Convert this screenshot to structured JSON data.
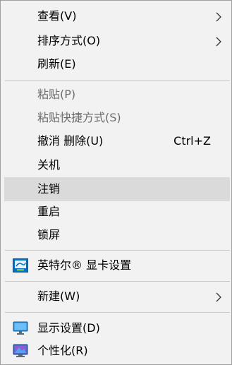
{
  "context_menu": {
    "items": [
      {
        "label": "查看(V)"
      },
      {
        "label": "排序方式(O)"
      },
      {
        "label": "刷新(E)"
      },
      {
        "label": "粘贴(P)"
      },
      {
        "label": "粘贴快捷方式(S)"
      },
      {
        "label": "撤消 删除(U)",
        "shortcut": "Ctrl+Z"
      },
      {
        "label": "关机"
      },
      {
        "label": "注销"
      },
      {
        "label": "重启"
      },
      {
        "label": "锁屏"
      },
      {
        "label": "英特尔® 显卡设置"
      },
      {
        "label": "新建(W)"
      },
      {
        "label": "显示设置(D)"
      },
      {
        "label": "个性化(R)"
      }
    ],
    "highlighted_item": "注销",
    "disabled_items": [
      "粘贴(P)",
      "粘贴快捷方式(S)"
    ],
    "icons": {
      "intel_graphics": "intel-graphics-icon",
      "display_settings": "monitor-icon",
      "personalize": "personalize-icon",
      "submenu": "chevron-right-icon"
    },
    "colors": {
      "menu_background": "#f2f2f2",
      "highlight": "#dadada",
      "disabled_text": "#6d6d6d",
      "separator": "#c8c8c8"
    }
  }
}
